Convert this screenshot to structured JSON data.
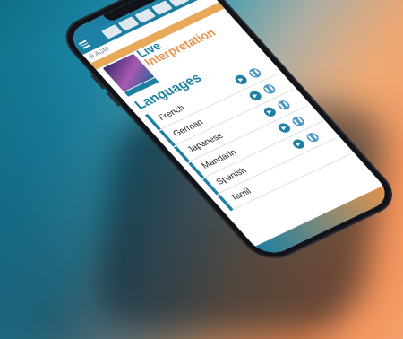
{
  "scene": {
    "background_colors": [
      "#0f6f86",
      "#3a9ab2",
      "#f2894e"
    ],
    "device": "smartphone"
  },
  "app": {
    "logo_text": "AGM",
    "hero_title_line1": "Live",
    "hero_title_line2": "Interpretation",
    "section_title": "Languages",
    "accent": "#1d7fa3",
    "secondary_accent": "#e3924c",
    "languages": [
      {
        "label": "French"
      },
      {
        "label": "German"
      },
      {
        "label": "Japanese"
      },
      {
        "label": "Mandarin"
      },
      {
        "label": "Spanish"
      },
      {
        "label": "Tamil"
      }
    ],
    "icons": {
      "menu": "menu-icon",
      "play": "play-icon",
      "pause": "pause-icon"
    }
  }
}
